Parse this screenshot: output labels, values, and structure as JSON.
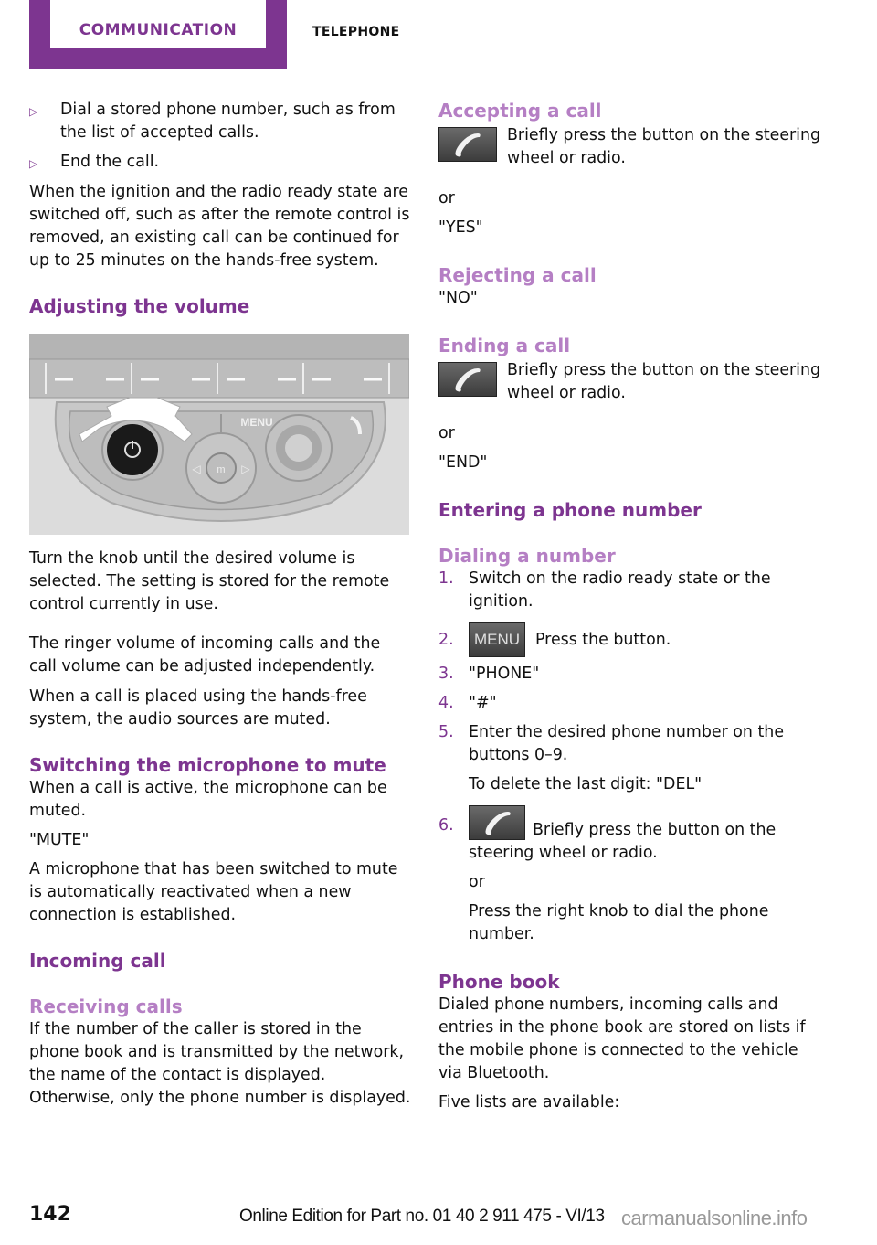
{
  "header": {
    "section_tab": "COMMUNICATION",
    "subsection": "TELEPHONE",
    "accent_color": "#7d3590",
    "light_accent_color": "#b57fc4"
  },
  "left": {
    "bullets": [
      "Dial a stored phone number, such as from the list of accepted calls.",
      "End the call."
    ],
    "para_ignition": "When the ignition and the radio ready state are switched off, such as after the remote control is removed, an existing call can be continued for up to 25 minutes on the hands-free system.",
    "heading_volume": "Adjusting the volume",
    "figure": {
      "name": "radio control panel with volume knob",
      "menu_label": "MENU",
      "center_button_label": "m"
    },
    "para_knob": "Turn the knob until the desired volume is selected. The setting is stored for the remote control currently in use.",
    "para_ringer": "The ringer volume of incoming calls and the call volume can be adjusted independently.",
    "para_muted": "When a call is placed using the hands-free system, the audio sources are muted.",
    "heading_mute": "Switching the microphone to mute",
    "para_mute_active": "When a call is active, the microphone can be muted.",
    "cmd_mute": "\"MUTE\"",
    "para_reactivated": "A microphone that has been switched to mute is automatically reactivated when a new connection is established.",
    "heading_incoming": "Incoming call",
    "heading_receiving": "Receiving calls",
    "para_receiving": "If the number of the caller is stored in the phone book and is transmitted by the network, the name of the contact is displayed. Otherwise, only the phone number is displayed."
  },
  "right": {
    "heading_accepting": "Accepting a call",
    "accept_text": "Briefly press the button on the steering wheel or radio.",
    "or_1": "or",
    "cmd_yes": "\"YES\"",
    "heading_rejecting": "Rejecting a call",
    "cmd_no": "\"NO\"",
    "heading_ending": "Ending a call",
    "end_text": "Briefly press the button on the steering wheel or radio.",
    "or_2": "or",
    "cmd_end": "\"END\"",
    "heading_entering": "Entering a phone number",
    "heading_dialing": "Dialing a number",
    "steps": [
      {
        "num": "1.",
        "text": "Switch on the radio ready state or the ignition."
      },
      {
        "num": "2.",
        "icon": "MENU",
        "text": "Press the button."
      },
      {
        "num": "3.",
        "text": "\"PHONE\""
      },
      {
        "num": "4.",
        "text": "\"#\""
      },
      {
        "num": "5.",
        "text": "Enter the desired phone number on the buttons 0–9.",
        "sub": "To delete the last digit: \"DEL\""
      },
      {
        "num": "6.",
        "text": "Briefly press the button on the steering wheel or radio.",
        "or": "or",
        "alt": "Press the right knob to dial the phone number."
      }
    ],
    "heading_phonebook": "Phone book",
    "para_phonebook": "Dialed phone numbers, incoming calls and entries in the phone book are stored on lists if the mobile phone is connected to the vehicle via Bluetooth.",
    "para_lists": "Five lists are available:"
  },
  "footer": {
    "page_number": "142",
    "edition": "Online Edition for Part no. 01 40 2 911 475 - VI/13",
    "watermark": "carmanualsonline.info"
  }
}
